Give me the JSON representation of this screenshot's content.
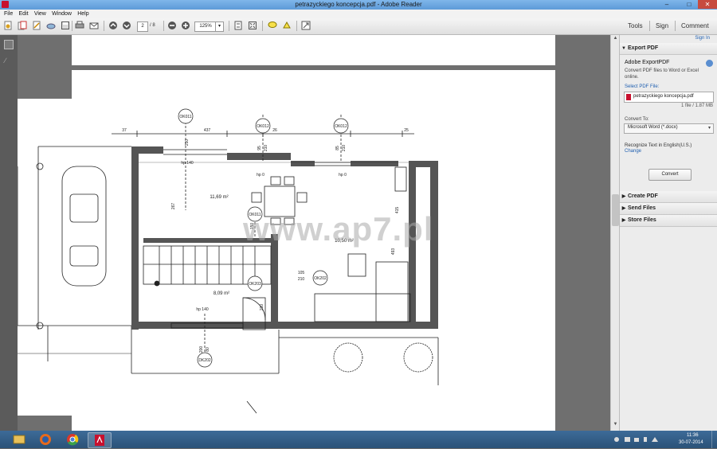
{
  "window": {
    "title": "petrazyckiego koncepcja.pdf - Adobe Reader",
    "controls": {
      "minimize": "–",
      "maximize": "□",
      "close": "✕"
    }
  },
  "menu": [
    "File",
    "Edit",
    "View",
    "Window",
    "Help"
  ],
  "toolbar": {
    "current_page": "2",
    "total_pages": "/ 8",
    "zoom": "125%",
    "right_tabs": {
      "tools": "Tools",
      "sign": "Sign",
      "comment": "Comment"
    }
  },
  "right_pane": {
    "sign_in": "Sign In",
    "export_pdf": {
      "header": "Export PDF",
      "title": "Adobe ExportPDF",
      "description": "Convert PDF files to Word or Excel online.",
      "select_label": "Select PDF File:",
      "file_name": "petrazyckiego koncepcja.pdf",
      "file_info": "1 file / 1.87 MB",
      "convert_to_label": "Convert To:",
      "convert_to_value": "Microsoft Word (*.docx)",
      "recognize_text": "Recognize Text in English(U.S.)",
      "change_link": "Change",
      "convert_button": "Convert"
    },
    "sections": [
      "Create PDF",
      "Send Files",
      "Store Files"
    ]
  },
  "drawing": {
    "watermark": "www.ap7.pl",
    "top_dims": [
      "37",
      "437",
      "26",
      "25"
    ],
    "door_labels": [
      "OK011",
      "OK012",
      "OK012",
      "OK011",
      "OK203",
      "OK202",
      "DK202"
    ],
    "room_1_area": "11,69 m²",
    "room_2_area": "10,50 m²",
    "room_3_area": "8,09 m²",
    "heights": [
      "hp 140",
      "hp 0",
      "hp 0",
      "hp 140"
    ],
    "door_sizes": [
      "105",
      "210"
    ],
    "small_dims": [
      "95",
      "210",
      "85",
      "210",
      "200",
      "80",
      "267",
      "493",
      "412",
      "415",
      "210",
      "150",
      "210"
    ]
  },
  "taskbar": {
    "time": "11:36",
    "date": "30-07-2014",
    "apps": [
      "file-explorer",
      "firefox",
      "chrome",
      "adobe-reader"
    ]
  },
  "colors": {
    "title_bar": "#6aa6e0",
    "taskbar": "#2f5c87",
    "link": "#1f5fb0"
  }
}
